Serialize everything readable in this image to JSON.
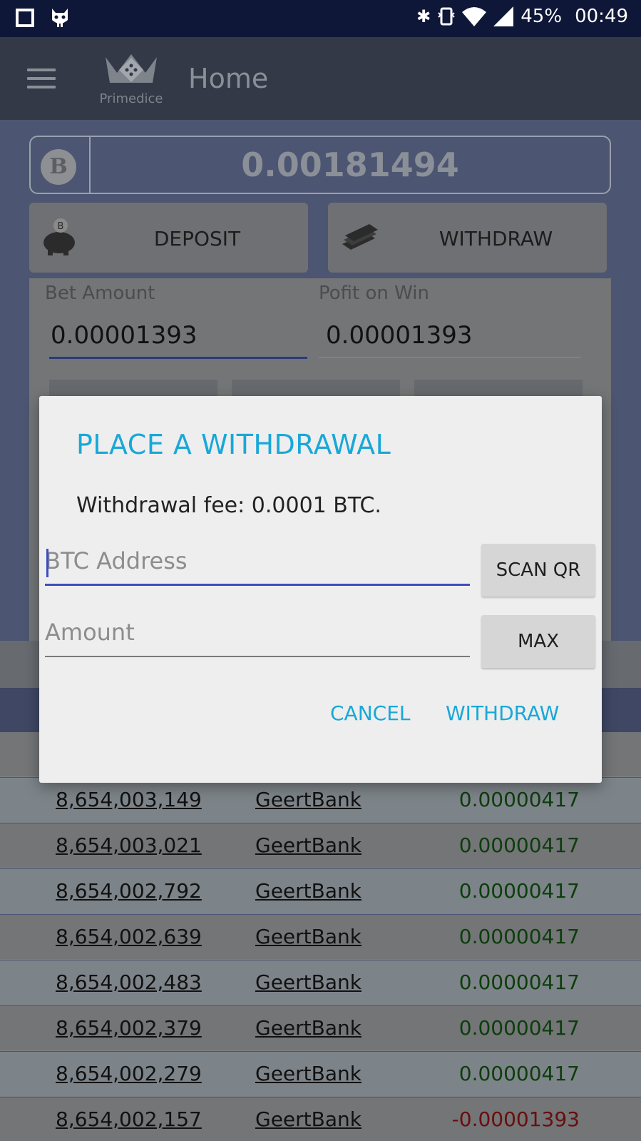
{
  "status_bar": {
    "battery": "45%",
    "time": "00:49",
    "icons": [
      "square-notification-icon",
      "cyanogen-mascot-icon",
      "bluetooth-icon",
      "vibrate-icon",
      "wifi-icon",
      "signal-icon"
    ]
  },
  "app_bar": {
    "title": "Home",
    "logo_text": "Primedice",
    "menu_icon": "hamburger-icon"
  },
  "balance": {
    "currency_icon": "bitcoin-coin-icon",
    "currency_symbol": "B",
    "value": "0.00181494"
  },
  "actions": {
    "deposit_label": "DEPOSIT",
    "withdraw_label": "WITHDRAW"
  },
  "bet_form": {
    "bet_amount_label": "Bet Amount",
    "bet_amount_value": "0.00001393",
    "profit_label": "Pofit on Win",
    "profit_value": "0.00001393"
  },
  "tabs_peek": "S",
  "bets": [
    {
      "id": "8,654,003,149",
      "user": "GeertBank",
      "profit": "0.00000417",
      "sign": "pos"
    },
    {
      "id": "8,654,003,021",
      "user": "GeertBank",
      "profit": "0.00000417",
      "sign": "pos"
    },
    {
      "id": "8,654,002,792",
      "user": "GeertBank",
      "profit": "0.00000417",
      "sign": "pos"
    },
    {
      "id": "8,654,002,639",
      "user": "GeertBank",
      "profit": "0.00000417",
      "sign": "pos"
    },
    {
      "id": "8,654,002,483",
      "user": "GeertBank",
      "profit": "0.00000417",
      "sign": "pos"
    },
    {
      "id": "8,654,002,379",
      "user": "GeertBank",
      "profit": "0.00000417",
      "sign": "pos"
    },
    {
      "id": "8,654,002,279",
      "user": "GeertBank",
      "profit": "0.00000417",
      "sign": "pos"
    },
    {
      "id": "8,654,002,157",
      "user": "GeertBank",
      "profit": "-0.00001393",
      "sign": "neg"
    }
  ],
  "dialog": {
    "title": "PLACE A WITHDRAWAL",
    "fee_text": "Withdrawal fee: 0.0001 BTC.",
    "address_placeholder": "BTC Address",
    "amount_placeholder": "Amount",
    "scan_label": "SCAN QR",
    "max_label": "MAX",
    "cancel_label": "CANCEL",
    "withdraw_label": "WITHDRAW",
    "accent_color": "#18a8d8",
    "focus_color": "#3a4ec0"
  }
}
